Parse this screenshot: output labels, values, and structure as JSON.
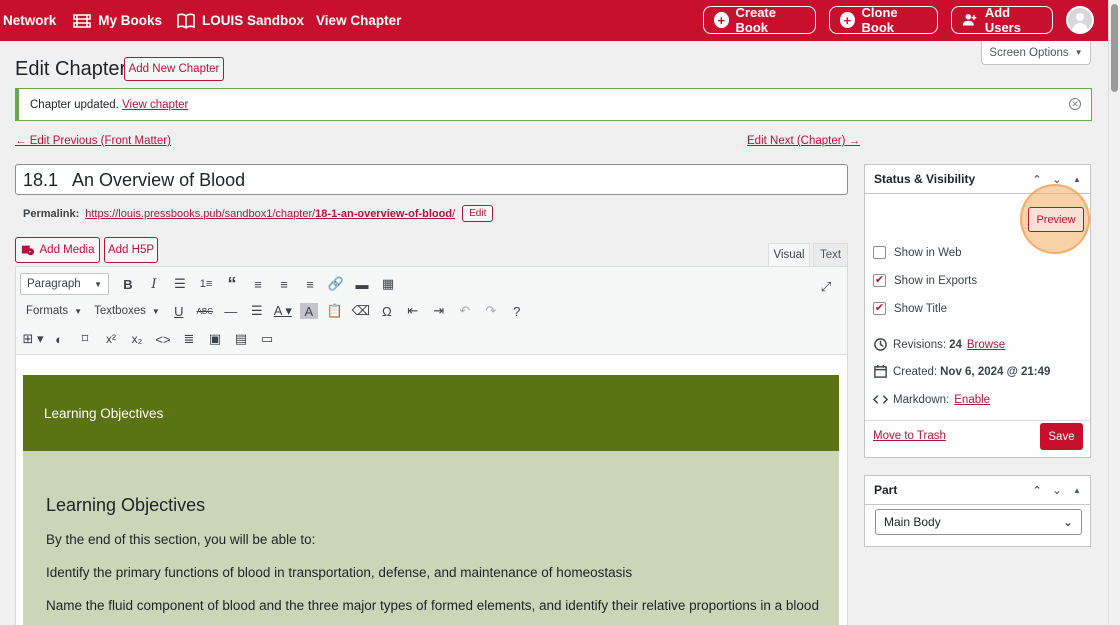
{
  "topbar": {
    "network": "Network",
    "my_books": "My Books",
    "book_name": "LOUIS Sandbox",
    "view_chapter": "View Chapter",
    "create_book": "Create Book",
    "clone_book": "Clone Book",
    "add_users": "Add Users"
  },
  "screen_options": "Screen Options",
  "page": {
    "title": "Edit Chapter",
    "add_new": "Add New Chapter"
  },
  "notice": {
    "text": "Chapter updated.",
    "link": "View chapter"
  },
  "nav": {
    "prev": "← Edit Previous (Front Matter)",
    "next": "Edit Next (Chapter) →"
  },
  "chapter": {
    "title": "18.1   An Overview of Blood",
    "permalink_label": "Permalink:",
    "permalink_prefix": "https://louis.pressbooks.pub/sandbox1/chapter/",
    "permalink_slug": "18-1-an-overview-of-blood",
    "permalink_suffix": "/",
    "edit": "Edit"
  },
  "media": {
    "add_media": "Add Media",
    "add_h5p": "Add H5P"
  },
  "tabs": {
    "visual": "Visual",
    "text": "Text"
  },
  "toolbar": {
    "paragraph": "Paragraph",
    "formats": "Formats",
    "textboxes": "Textboxes"
  },
  "content": {
    "box_header": "Learning Objectives",
    "heading": "Learning Objectives",
    "intro": "By the end of this section, you will be able to:",
    "obj1": "Identify the primary functions of blood in transportation, defense, and maintenance of homeostasis",
    "obj2": "Name the fluid component of blood and the three major types of formed elements, and identify their relative proportions in a blood"
  },
  "status": {
    "title": "Status & Visibility",
    "preview": "Preview",
    "show_web": "Show in Web",
    "show_exports": "Show in Exports",
    "show_title": "Show Title",
    "revisions_label": "Revisions:",
    "revisions_count": "24",
    "browse": "Browse",
    "created_label": "Created:",
    "created_value": "Nov 6, 2024 @ 21:49",
    "markdown_label": "Markdown:",
    "markdown_link": "Enable",
    "trash": "Move to Trash",
    "save": "Save",
    "show_web_checked": false,
    "show_exports_checked": true,
    "show_title_checked": true
  },
  "part": {
    "title": "Part",
    "value": "Main Body"
  },
  "colors": {
    "brand": "#c8102e",
    "lo_header": "#5a7313",
    "lo_body": "#cbd6b8"
  }
}
